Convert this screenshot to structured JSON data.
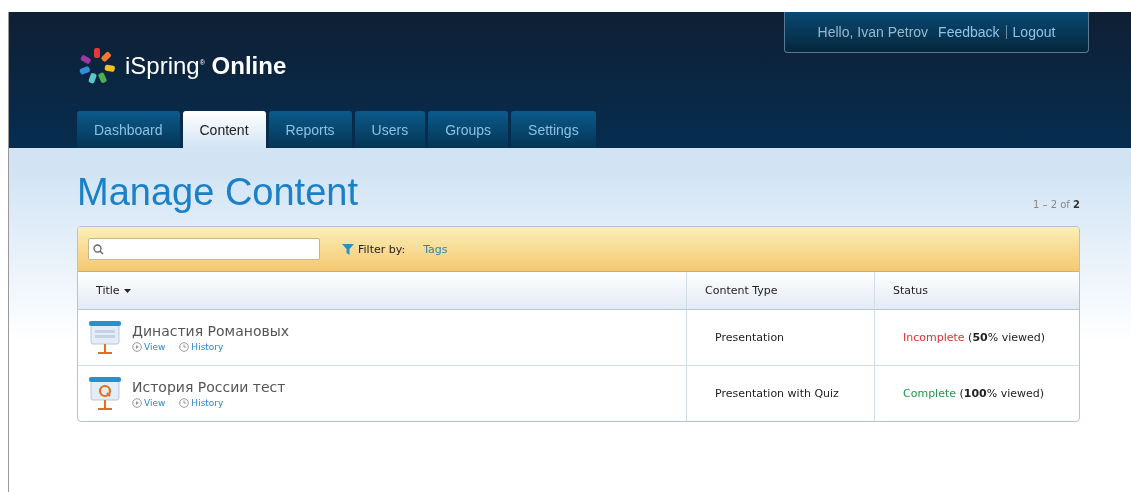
{
  "header": {
    "logo": {
      "brand": "iSpring",
      "reg": "®",
      "product": "Online"
    },
    "greeting": "Hello, Ivan Petrov",
    "links": [
      {
        "label": "Feedback"
      },
      {
        "label": "Logout"
      }
    ]
  },
  "tabs": [
    {
      "label": "Dashboard",
      "selected": false
    },
    {
      "label": "Content",
      "selected": true
    },
    {
      "label": "Reports",
      "selected": false
    },
    {
      "label": "Users",
      "selected": false
    },
    {
      "label": "Groups",
      "selected": false
    },
    {
      "label": "Settings",
      "selected": false
    }
  ],
  "page_title": "Manage Content",
  "pagination": "1 – 2 of **2**",
  "toolbar": {
    "filter_label": "Filter by:",
    "filter_link": "Tags"
  },
  "table": {
    "columns": [
      {
        "label": "Title",
        "sorted": true
      },
      {
        "label": "Content Type",
        "sorted": false
      },
      {
        "label": "Status",
        "sorted": false
      }
    ],
    "rows": [
      {
        "kind": "presentation",
        "title": "Династия Романовых",
        "actions": [
          "View",
          "History"
        ],
        "type": "Presentation",
        "status": {
          "kind": "incomplete",
          "label": "Incomplete",
          "detail": "(**50**% viewed)"
        }
      },
      {
        "kind": "quiz",
        "title": "История России тест",
        "actions": [
          "View",
          "History"
        ],
        "type": "Presentation with Quiz",
        "status": {
          "kind": "complete",
          "label": "Complete",
          "detail": "(**100**% viewed)"
        }
      }
    ]
  }
}
